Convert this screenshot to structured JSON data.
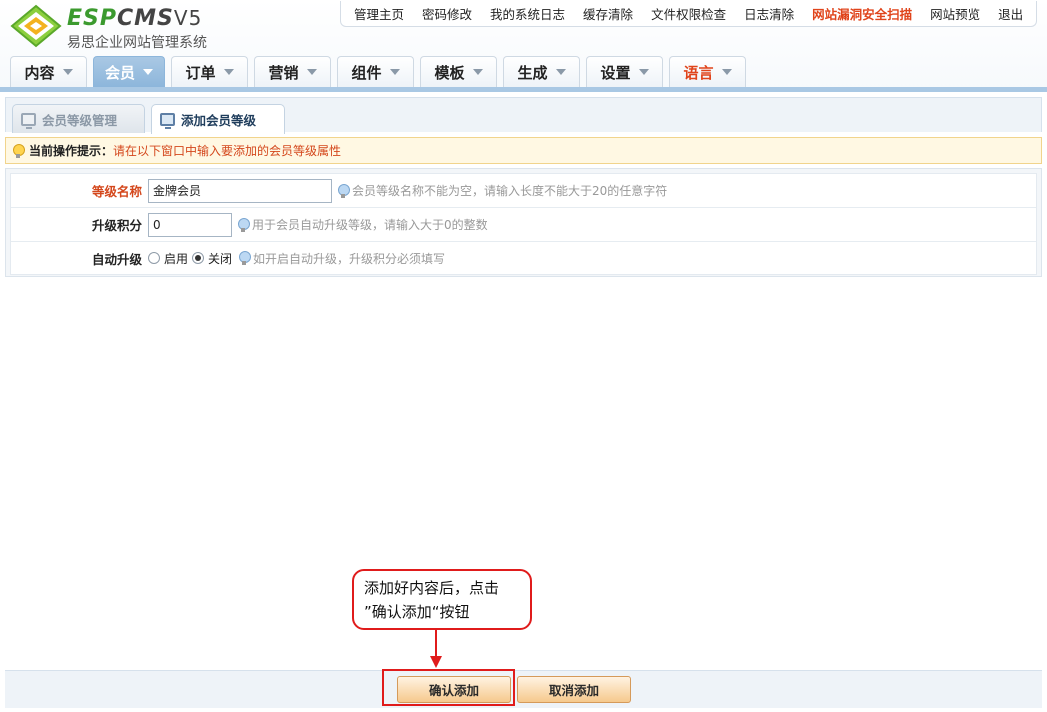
{
  "logo": {
    "brand_esp": "ESP",
    "brand_cms": "CMS",
    "brand_ver": "V5",
    "subtitle": "易思企业网站管理系统"
  },
  "topnav": [
    "管理主页",
    "密码修改",
    "我的系统日志",
    "缓存清除",
    "文件权限检查",
    "日志清除",
    "网站漏洞安全扫描",
    "网站预览",
    "退出"
  ],
  "mainnav": [
    "内容",
    "会员",
    "订单",
    "营销",
    "组件",
    "模板",
    "生成",
    "设置",
    "语言"
  ],
  "subtabs": {
    "manage": "会员等级管理",
    "add": "添加会员等级"
  },
  "hint": {
    "label": "当前操作提示：",
    "text": "请在以下窗口中输入要添加的会员等级属性"
  },
  "form": {
    "name_label": "等级名称",
    "name_value": "金牌会员",
    "name_tip": "会员等级名称不能为空，请输入长度不能大于20的任意字符",
    "points_label": "升级积分",
    "points_value": "0",
    "points_tip": "用于会员自动升级等级，请输入大于0的整数",
    "auto_label": "自动升级",
    "auto_on": "启用",
    "auto_off": "关闭",
    "auto_tip": "如开启自动升级，升级积分必须填写"
  },
  "callout": {
    "line1": "添加好内容后，点击",
    "line2": "”确认添加“按钮"
  },
  "buttons": {
    "confirm": "确认添加",
    "cancel": "取消添加"
  }
}
